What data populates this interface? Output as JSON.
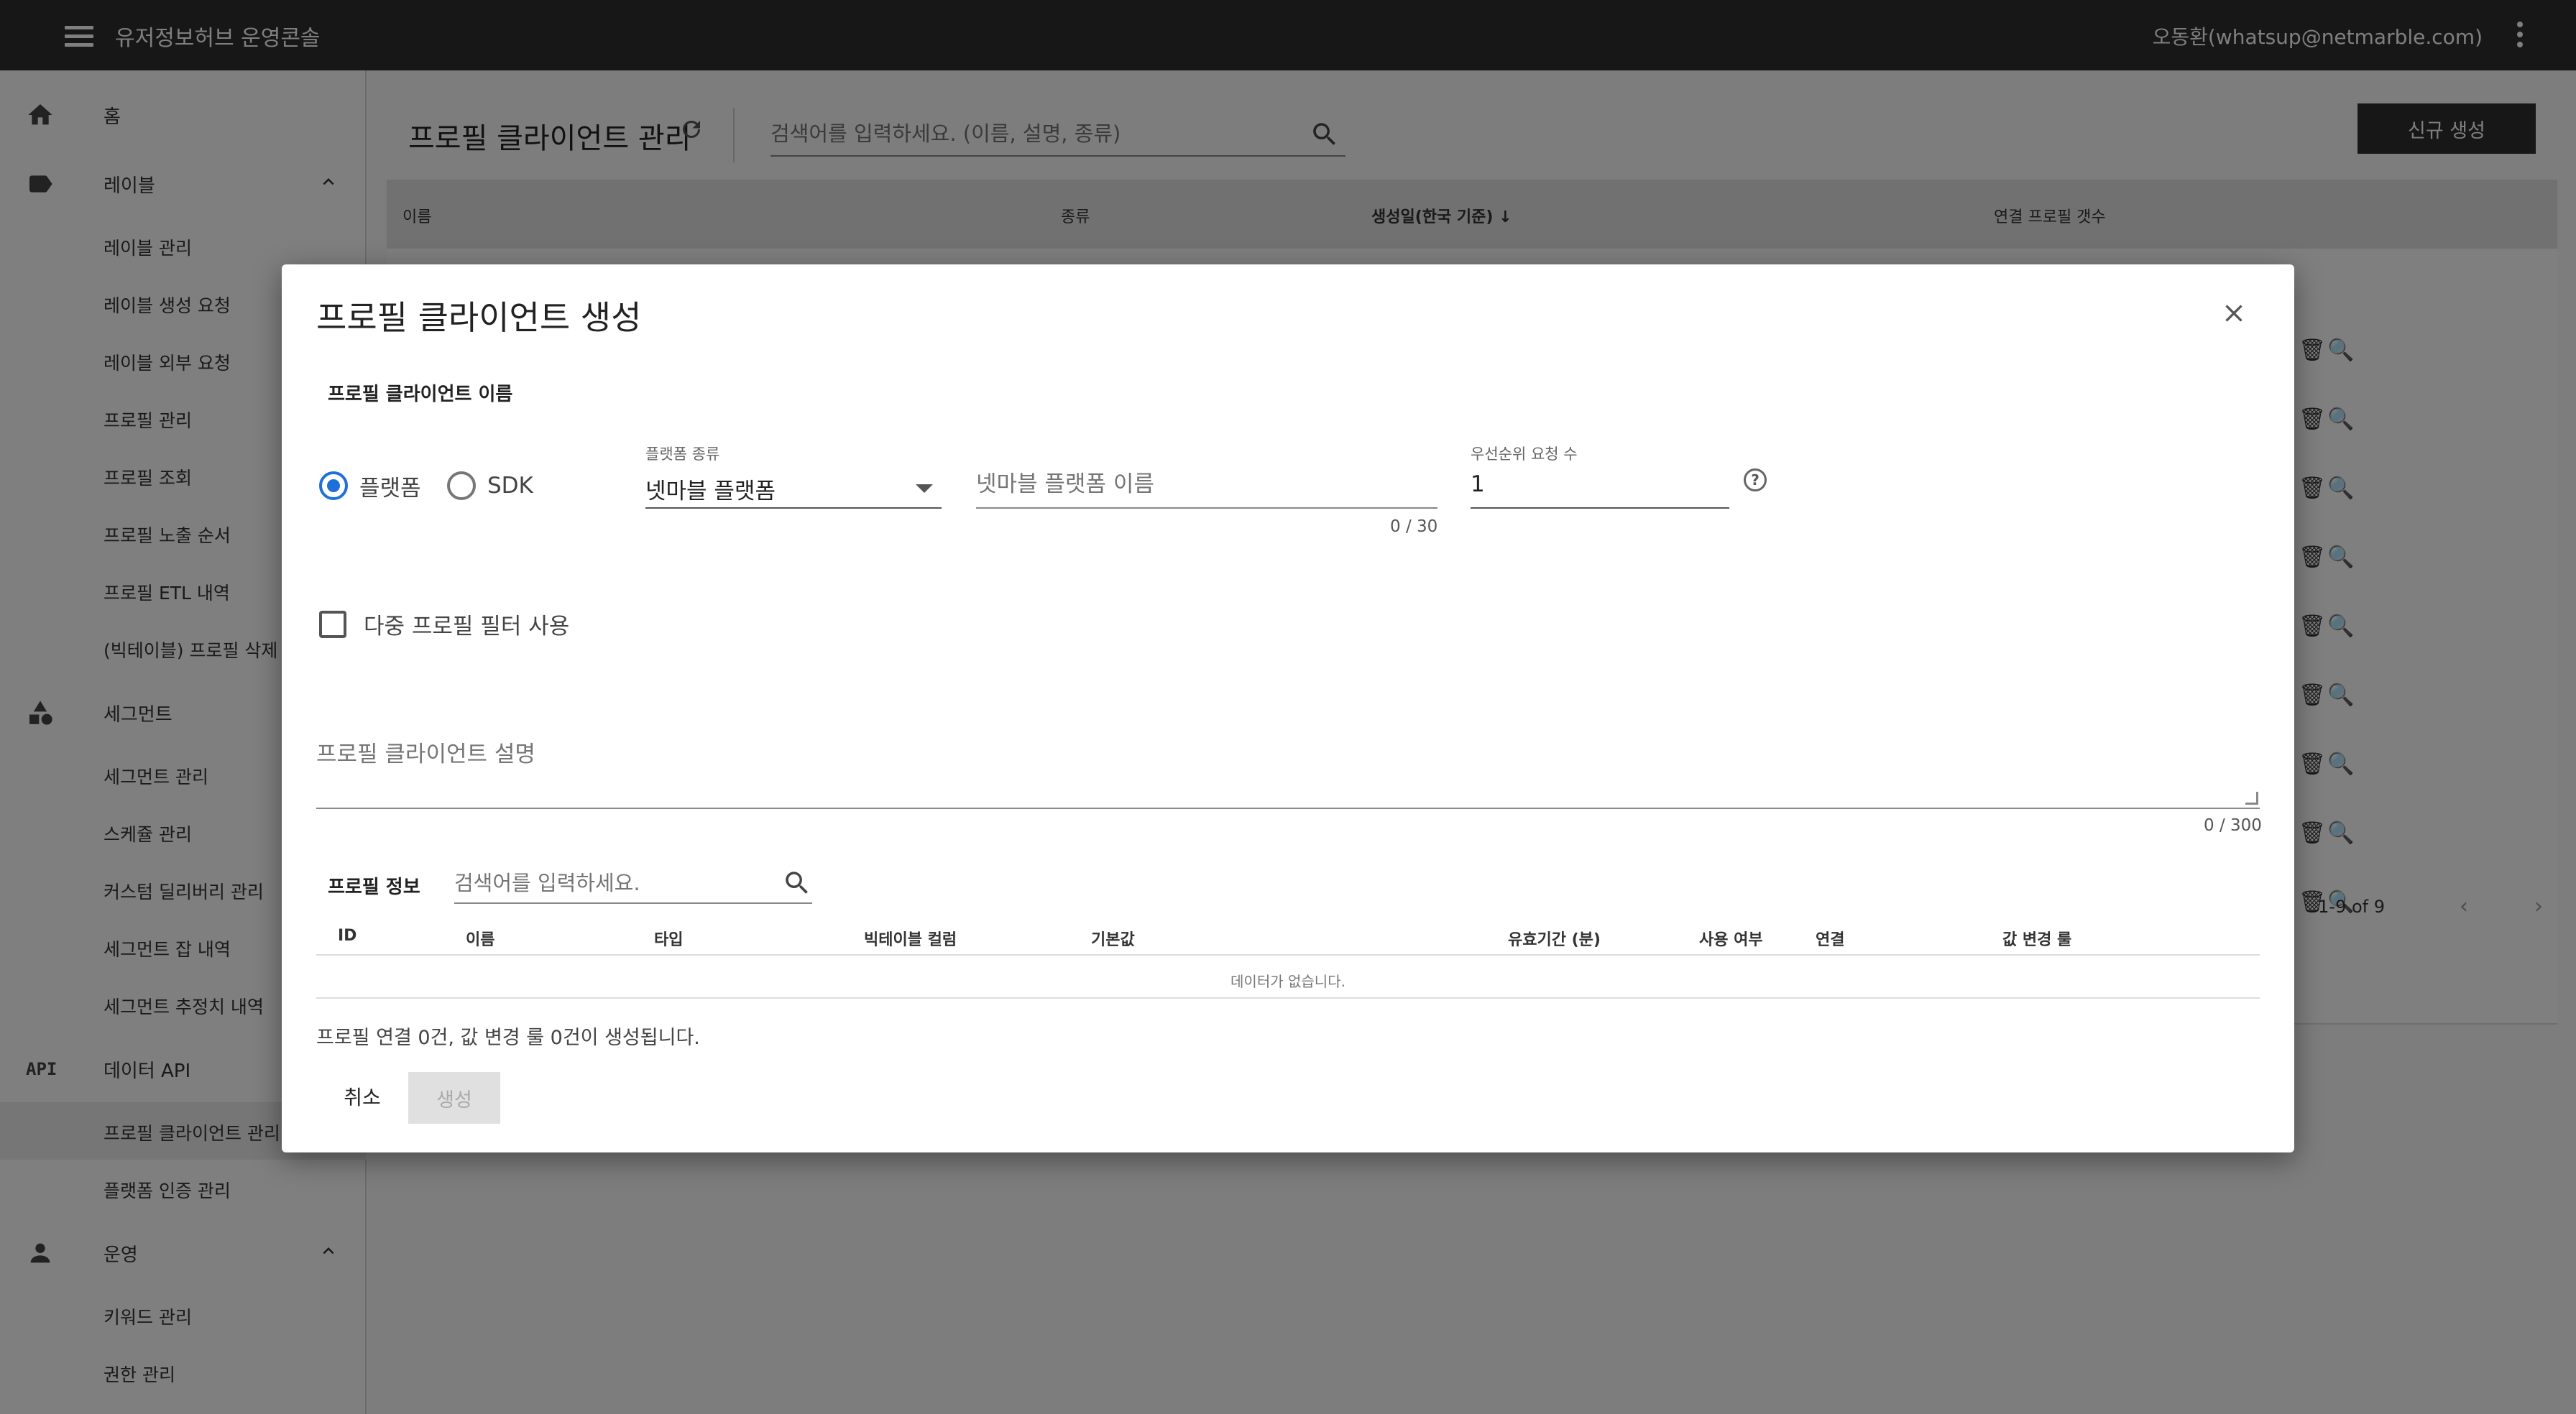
{
  "app": {
    "title": "유저정보허브 운영콘솔",
    "user": "오동환(whatsup@netmarble.com)"
  },
  "sidebar": {
    "home": "홈",
    "label_group": "레이블",
    "label_items": [
      "레이블 관리",
      "레이블 생성 요청",
      "레이블 외부 요청",
      "프로필 관리",
      "프로필 조회",
      "프로필 노출 순서",
      "프로필 ETL 내역",
      "(빅테이블) 프로필 삭제 내역"
    ],
    "segment_group": "세그먼트",
    "segment_items": [
      "세그먼트 관리",
      "스케쥴 관리",
      "커스텀 딜리버리 관리",
      "세그먼트 잡 내역",
      "세그먼트 추정치 내역"
    ],
    "api_group": "데이터 API",
    "api_items": [
      "프로필 클라이언트 관리",
      "플랫폼 인증 관리"
    ],
    "ops_group": "운영",
    "ops_items": [
      "키워드 관리",
      "권한 관리"
    ]
  },
  "main": {
    "title": "프로필 클라이언트 관리",
    "search_placeholder": "검색어를 입력하세요. (이름, 설명, 종류)",
    "new_button": "신규 생성",
    "columns": [
      "이름",
      "종류",
      "생성일(한국 기준) ↓",
      "연결 프로필 갯수"
    ],
    "pagination": "1-9 of 9"
  },
  "modal": {
    "title": "프로필 클라이언트 생성",
    "name_section": "프로필 클라이언트 이름",
    "radio_platform": "플랫폼",
    "radio_sdk": "SDK",
    "platform_type_label": "플랫폼 종류",
    "platform_type_value": "넷마블 플랫폼",
    "platform_name_placeholder": "넷마블 플랫폼 이름",
    "platform_name_counter": "0 / 30",
    "priority_label": "우선순위 요청 수",
    "priority_value": "1",
    "multi_filter_label": "다중 프로필 필터 사용",
    "description_placeholder": "프로필 클라이언트 설명",
    "description_counter": "0 / 300",
    "info_section": "프로필 정보",
    "info_search_placeholder": "검색어를 입력하세요.",
    "info_columns": [
      "ID",
      "이름",
      "타입",
      "빅테이블 컬럼",
      "기본값",
      "유효기간 (분)",
      "사용 여부",
      "연결",
      "값 변경 룰"
    ],
    "empty_text": "데이터가 없습니다.",
    "summary": "프로필 연결 0건, 값 변경 룰 0건이 생성됩니다.",
    "cancel": "취소",
    "create": "생성"
  },
  "colors": {
    "accent": "#1e6fd9",
    "topbar": "#2e2e2e"
  }
}
